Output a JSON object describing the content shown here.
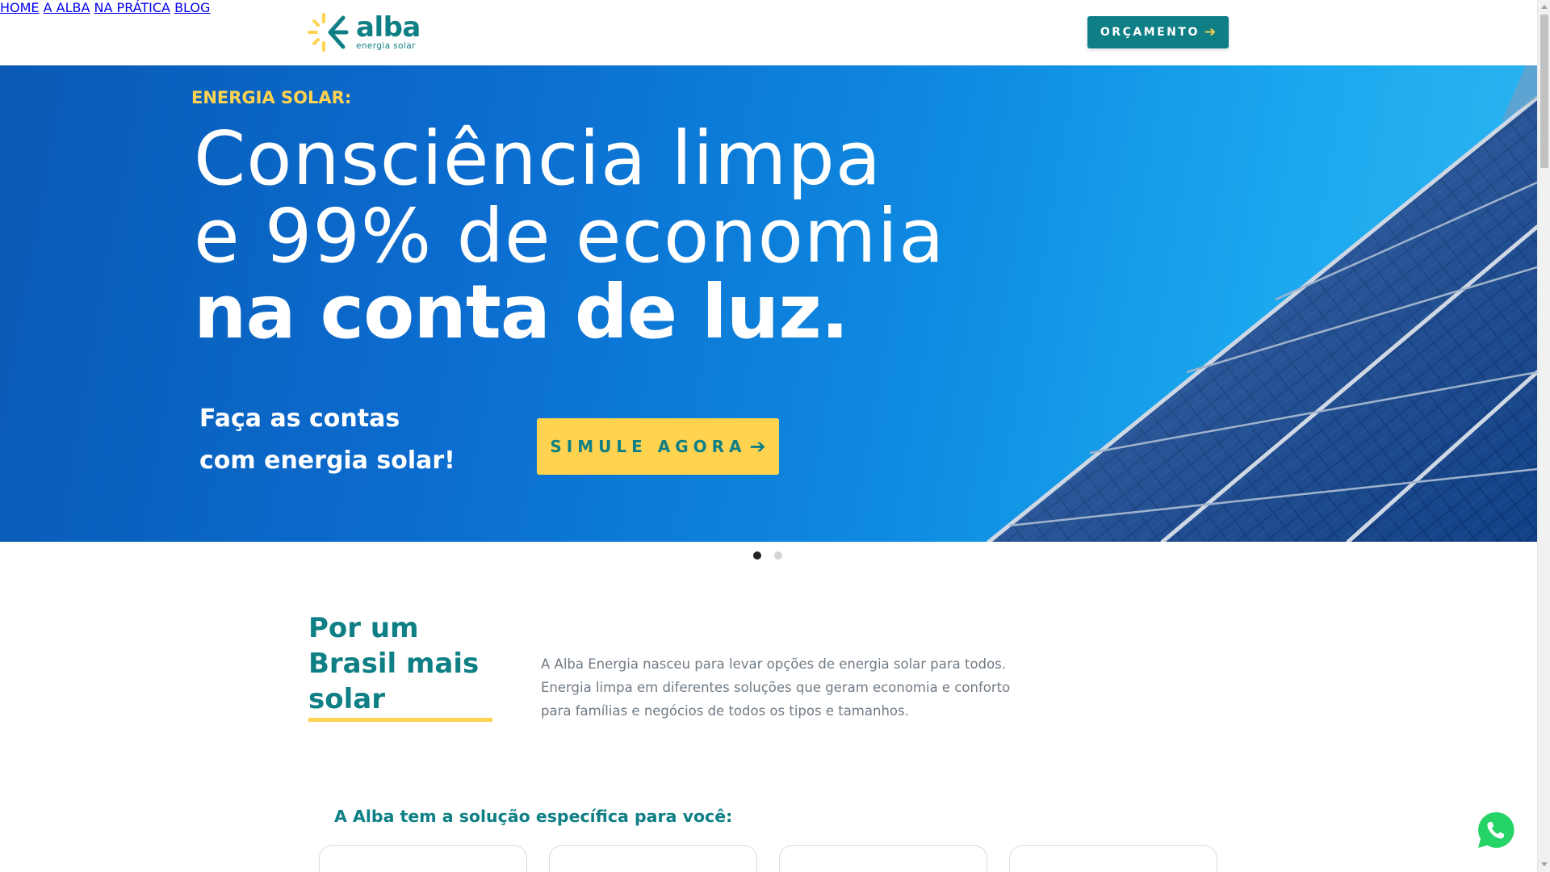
{
  "brand": {
    "name": "alba",
    "tagline": "energia solar",
    "colors": {
      "teal": "#0f7f86",
      "yellow": "#ffd34f",
      "hero_blue": "#0b6ccf"
    }
  },
  "nav": {
    "items": [
      {
        "label": "HOME"
      },
      {
        "label": "A ALBA"
      },
      {
        "label": "NA PRÁTICA"
      },
      {
        "label": "BLOG"
      }
    ],
    "cta_label": "ORÇAMENTO",
    "cta_icon": "arrow-right-icon"
  },
  "hero": {
    "eyebrow": "ENERGIA SOLAR:",
    "headline_line1": "Consciência limpa",
    "headline_line2": "e 99% de economia",
    "headline_line3": "na conta de luz.",
    "sub_line1": "Faça as contas",
    "sub_line2": "com energia solar!",
    "cta_label": "SIMULE AGORA",
    "cta_icon": "arrow-right-icon",
    "slide_count": 2,
    "active_slide": 1
  },
  "about": {
    "title": "Por um Brasil mais solar",
    "text": "A Alba Energia nasceu para levar opções de energia solar para todos. Energia limpa em diferentes soluções que geram economia e conforto para famílias e negócios de todos os tipos e tamanhos."
  },
  "solutions": {
    "title": "A Alba tem a solução específica para você:"
  },
  "floating": {
    "whatsapp_icon": "whatsapp-icon"
  }
}
